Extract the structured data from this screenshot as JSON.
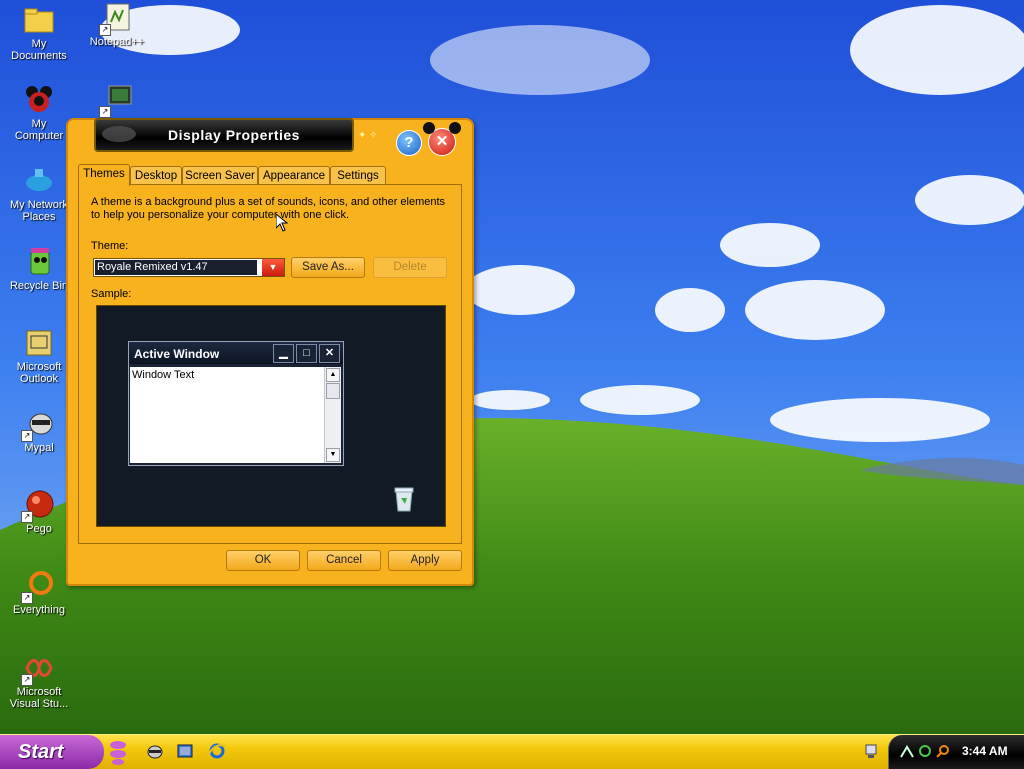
{
  "desktop": {
    "icons": [
      {
        "label": "My\nDocuments"
      },
      {
        "label": "Notepad++"
      },
      {
        "label": "My\nComputer"
      },
      {
        "label": "My Network\nPlaces"
      },
      {
        "label": "Recycle Bin"
      },
      {
        "label": "Microsoft\nOutlook"
      },
      {
        "label": "Mypal"
      },
      {
        "label": "Pego"
      },
      {
        "label": "Everything"
      },
      {
        "label": "Microsoft\nVisual Stu..."
      }
    ]
  },
  "dialog": {
    "title": "Display Properties",
    "help_glyph": "?",
    "close_glyph": "✕",
    "tabs": [
      "Themes",
      "Desktop",
      "Screen Saver",
      "Appearance",
      "Settings"
    ],
    "active_tab": "Themes",
    "description": "A theme is a background plus a set of sounds, icons, and other elements to help you personalize your computer with one click.",
    "theme_label": "Theme:",
    "theme_value": "Royale Remixed v1.47",
    "save_as": "Save As...",
    "delete": "Delete",
    "sample_label": "Sample:",
    "sample": {
      "window_title": "Active Window",
      "window_text": "Window Text"
    },
    "ok": "OK",
    "cancel": "Cancel",
    "apply": "Apply"
  },
  "taskbar": {
    "start_label": "Start",
    "clock": "3:44 AM"
  },
  "colors": {
    "dialog_bg": "#f7b21e",
    "titlebar_bg": "#000000",
    "start_button": "#9a3ab8",
    "taskbar": "#f2c80c"
  }
}
